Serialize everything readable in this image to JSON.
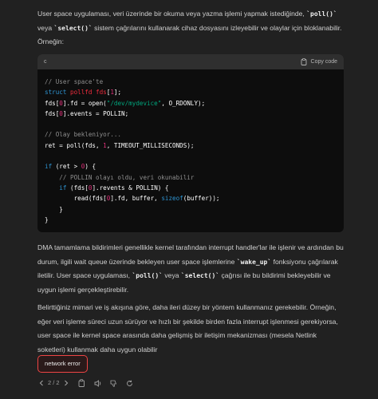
{
  "para1": {
    "t1": "User space uygulaması, veri üzerinde bir okuma veya yazma işlemi yapmak istediğinde, ",
    "c1": "`poll()`",
    "t2": " veya ",
    "c2": "`select()`",
    "t3": " sistem çağrılarını kullanarak cihaz dosyasını izleyebilir ve olaylar için bloklanabilir. Örneğin:"
  },
  "code": {
    "language": "c",
    "copy_label": "Copy code",
    "lines": {
      "l1": "// User space'te",
      "l2a": "struct",
      "l2b": " pollfd ",
      "l2c": "fds",
      "l2d": "[",
      "l2e": "1",
      "l2f": "];",
      "l3a": "fds[",
      "l3b": "0",
      "l3c": "].fd = open(",
      "l3d": "\"/dev/mydevice\"",
      "l3e": ", O_RDONLY);",
      "l4a": "fds[",
      "l4b": "0",
      "l4c": "].events = POLLIN;",
      "l6": "// Olay bekleniyor...",
      "l7a": "ret = poll(fds, ",
      "l7b": "1",
      "l7c": ", TIMEOUT_MILLISECONDS);",
      "l9a": "if",
      "l9b": " (ret > ",
      "l9c": "0",
      "l9d": ") {",
      "l10": "    // POLLIN olayı oldu, veri okunabilir",
      "l11a": "    ",
      "l11b": "if",
      "l11c": " (fds[",
      "l11d": "0",
      "l11e": "].revents & POLLIN) {",
      "l12a": "        read(fds[",
      "l12b": "0",
      "l12c": "].fd, buffer, ",
      "l12d": "sizeof",
      "l12e": "(buffer));",
      "l13": "    }",
      "l14": "}"
    }
  },
  "para2": {
    "t1": "DMA tamamlama bildirimleri genellikle kernel tarafından interrupt handler'lar ile işlenir ve ardından bu durum, ilgili wait queue üzerinde bekleyen user space işlemlerine ",
    "c1": "`wake_up`",
    "t2": " fonksiyonu çağrılarak iletilir. User space uygulaması, ",
    "c2": "`poll()`",
    "t3": " veya ",
    "c3": "`select()`",
    "t4": " çağrısı ile bu bildirimi bekleyebilir ve uygun işlemi gerçekleştirebilir."
  },
  "para3": {
    "text": "Belirttiğiniz mimari ve iş akışına göre, daha ileri düzey bir yöntem kullanmanız gerekebilir. Örneğin, eğer veri işleme süreci uzun sürüyor ve hızlı bir şekilde birden fazla interrupt işlenmesi gerekiyorsa, user space ile kernel space arasında daha gelişmiş bir iletişim mekanizması (mesela Netlink soketleri) kullanmak daha uygun olabilir"
  },
  "error_button": "network error",
  "pager": {
    "label": "2 / 2"
  },
  "icons": [
    "chevron-left-icon",
    "chevron-right-icon",
    "clipboard-icon",
    "speaker-icon",
    "thumbs-down-icon",
    "refresh-icon"
  ]
}
